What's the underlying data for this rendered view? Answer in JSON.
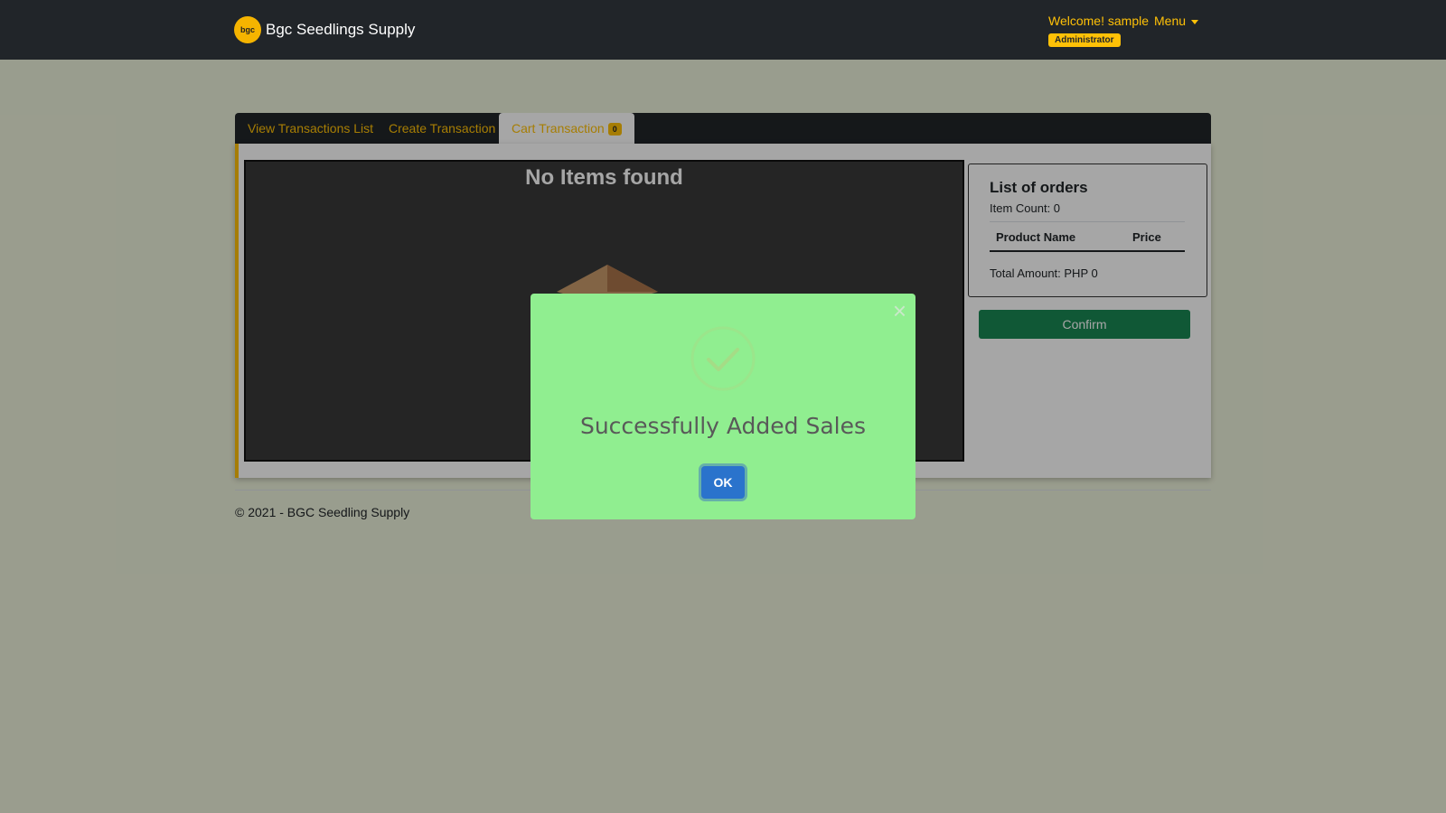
{
  "navbar": {
    "logo_text": "bgc",
    "brand": "Bgc Seedlings Supply",
    "welcome": "Welcome! sample",
    "menu_label": "Menu",
    "role": "Administrator"
  },
  "tabs": [
    {
      "label": "View Transactions List"
    },
    {
      "label": "Create Transaction"
    },
    {
      "label": "Cart Transaction",
      "count": "0",
      "active": true
    }
  ],
  "items": {
    "empty_text": "No Items found"
  },
  "orders": {
    "title": "List of orders",
    "item_count": "Item Count: 0",
    "columns": [
      "Product Name",
      "Price"
    ],
    "total": "Total Amount: PHP 0",
    "confirm_label": "Confirm"
  },
  "footer": {
    "text": "© 2021 - BGC Seedling Supply"
  },
  "modal": {
    "close": "×",
    "title": "Successfully Added Sales",
    "ok_label": "OK"
  }
}
